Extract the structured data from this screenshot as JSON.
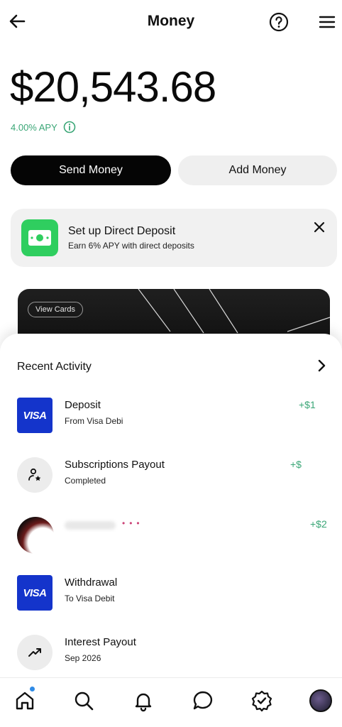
{
  "header": {
    "title": "Money",
    "back_icon": "arrow-left-icon",
    "help_icon": "question-circle-icon",
    "menu_icon": "hamburger-menu-icon"
  },
  "balance": {
    "amount": "$20,543.68",
    "apy": "4.00% APY",
    "apy_color": "#3aa676"
  },
  "actions": {
    "send_label": "Send Money",
    "add_label": "Add Money"
  },
  "promo": {
    "title": "Set up Direct Deposit",
    "subtitle": "Earn 6% APY with direct deposits",
    "icon": "cash-bill-icon",
    "icon_color": "#2fce5f"
  },
  "card": {
    "view_cards_label": "View Cards"
  },
  "recent": {
    "title": "Recent Activity",
    "items": [
      {
        "name": "Deposit",
        "sub": "From Visa Debi",
        "amount": "+$1",
        "icon": "visa-icon"
      },
      {
        "name": "Subscriptions Payout",
        "sub": "Completed",
        "amount": "+$",
        "icon": "person-star-icon"
      },
      {
        "name": "",
        "sub": "",
        "amount": "+$2",
        "icon": "avatar-icon"
      },
      {
        "name": "Withdrawal",
        "sub": "To Visa Debit",
        "amount": "",
        "icon": "visa-icon"
      },
      {
        "name": "Interest Payout",
        "sub": "Sep 2026",
        "amount": "",
        "icon": "trending-up-icon"
      }
    ],
    "visa_label": "VISA"
  },
  "nav": {
    "items": [
      "home-icon",
      "search-icon",
      "bell-icon",
      "chat-icon",
      "verified-badge-icon",
      "profile-avatar"
    ],
    "active_dot_color": "#2f8be6"
  }
}
